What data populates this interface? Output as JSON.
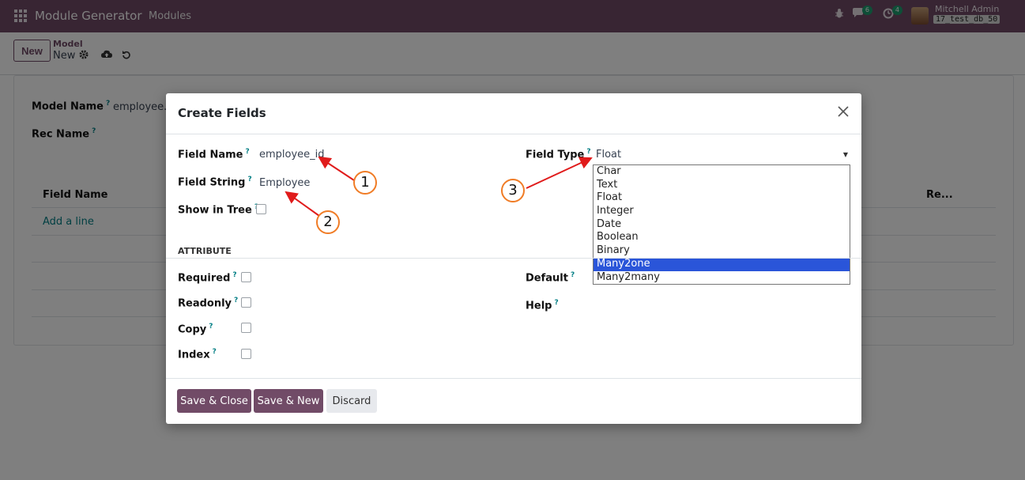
{
  "navbar": {
    "app_name": "Module Generator",
    "menu": "Modules",
    "chat_count": "6",
    "activity_count": "4",
    "user_name": "Mitchell Admin",
    "db_name": "17_test_db_50"
  },
  "control_panel": {
    "new_button": "New",
    "breadcrumb_parent": "Model",
    "breadcrumb_current": "New"
  },
  "background_form": {
    "model_name_label": "Model Name",
    "model_name_value": "employee.a",
    "rec_name_label": "Rec Name",
    "col_field_name": "Field Name",
    "col_required": "Re...",
    "add_line": "Add a line"
  },
  "modal": {
    "title": "Create Fields",
    "field_name_label": "Field Name",
    "field_name_value": "employee_id",
    "field_string_label": "Field String",
    "field_string_value": "Employee",
    "show_in_tree_label": "Show in Tree",
    "field_type_label": "Field Type",
    "field_type_value": "Float",
    "attribute_header": "ATTRIBUTE",
    "required_label": "Required",
    "readonly_label": "Readonly",
    "copy_label": "Copy",
    "index_label": "Index",
    "default_label": "Default",
    "help_label": "Help",
    "help_marker": "?",
    "dropdown_options": [
      "Char",
      "Text",
      "Float",
      "Integer",
      "Date",
      "Boolean",
      "Binary",
      "Many2one",
      "Many2many"
    ],
    "dropdown_highlighted": "Many2one",
    "save_close": "Save & Close",
    "save_new": "Save & New",
    "discard": "Discard"
  },
  "annotations": {
    "marker1": "1",
    "marker2": "2",
    "marker3": "3"
  },
  "colors": {
    "brand": "#714b67",
    "link": "#017e84",
    "badge": "#1c9c6f",
    "highlight": "#2a55d9",
    "annotation": "#f07c26",
    "arrow": "#e01b1b"
  },
  "icons": {
    "apps": "apps-grid-icon",
    "bug": "bug-icon",
    "chat": "chat-icon",
    "activity": "clock-icon",
    "settings": "gear-icon",
    "save": "cloud-upload-icon",
    "discard": "undo-icon",
    "close": "close-icon"
  }
}
